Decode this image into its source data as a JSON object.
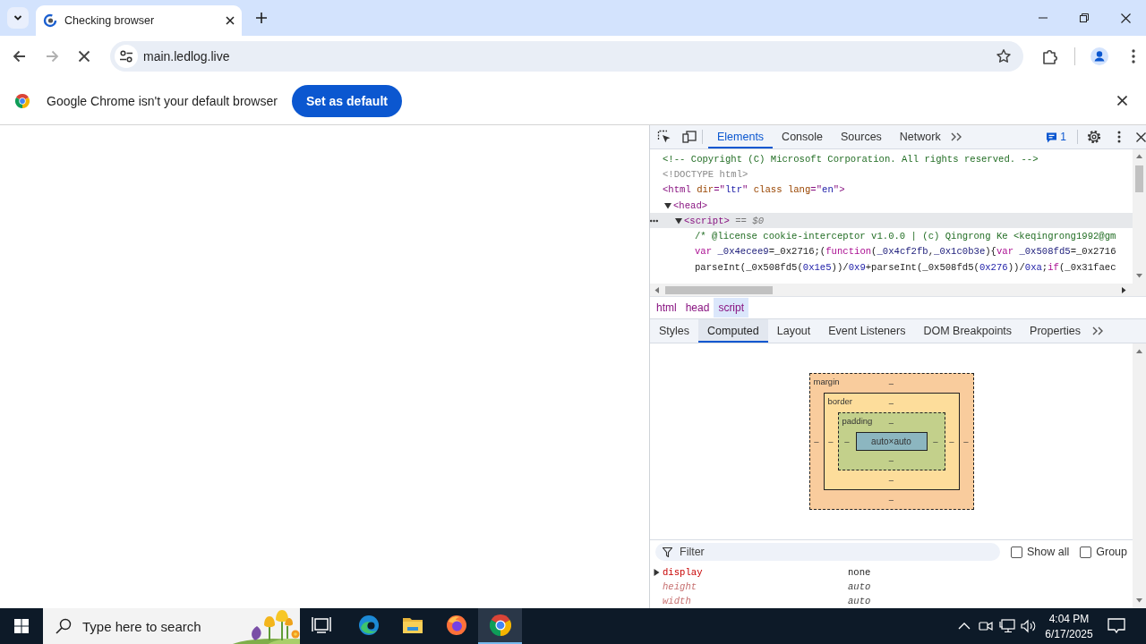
{
  "browser": {
    "tabs": [
      {
        "title": "Checking browser",
        "selected": true
      }
    ],
    "nav_buttons": [
      {
        "kind": "back",
        "disabled": false
      },
      {
        "kind": "forward",
        "disabled": true
      },
      {
        "kind": "stop",
        "disabled": false
      }
    ],
    "address": {
      "url": "main.ledlog.live",
      "bookmarked": false
    },
    "infobar": {
      "message": "Google Chrome isn't your default browser",
      "button": "Set as default"
    }
  },
  "devtools": {
    "tabs": [
      {
        "label": "Elements",
        "selected": true
      },
      {
        "label": "Console",
        "selected": false
      },
      {
        "label": "Sources",
        "selected": false
      },
      {
        "label": "Network",
        "selected": false
      }
    ],
    "issues": "1",
    "dom_tree": [
      {
        "selected": false,
        "tokens": [
          {
            "kind": "comment",
            "text": "<!-- Copyright (C) Microsoft Corporation. All rights reserved. -->"
          }
        ]
      },
      {
        "selected": false,
        "tokens": [
          {
            "kind": "doctype",
            "text": "<!DOCTYPE html>"
          }
        ]
      },
      {
        "selected": false,
        "tokens": [
          {
            "kind": "tag",
            "text": "<html"
          },
          {
            "kind": "attr",
            "text": " dir"
          },
          {
            "kind": "tag",
            "text": "=\""
          },
          {
            "kind": "value",
            "text": "ltr"
          },
          {
            "kind": "tag",
            "text": "\""
          },
          {
            "kind": "attr",
            "text": " class"
          },
          {
            "kind": "attr",
            "text": " lang"
          },
          {
            "kind": "tag",
            "text": "=\""
          },
          {
            "kind": "value",
            "text": "en"
          },
          {
            "kind": "tag",
            "text": "\">"
          }
        ],
        "children": [
          {
            "selected": false,
            "expanded": true,
            "tokens": [
              {
                "kind": "tag",
                "text": "<head>"
              }
            ],
            "children": [
              {
                "selected": true,
                "expanded": true,
                "tokens": [
                  {
                    "kind": "tag",
                    "text": "<script>"
                  },
                  {
                    "kind": "ref",
                    "text": " == $0"
                  }
                ],
                "children": [
                  {
                    "selected": false,
                    "tokens": [
                      {
                        "kind": "comment",
                        "text": "/* @license cookie-interceptor v1.0.0 | (c) Qingrong Ke <keqingrong1992@gm"
                      }
                    ]
                  },
                  {
                    "selected": false,
                    "tokens": [
                      {
                        "kind": "keyword",
                        "text": "var"
                      },
                      {
                        "kind": "def",
                        "text": " _0x4ecee9"
                      },
                      {
                        "kind": "plain",
                        "text": "=_0x2716;("
                      },
                      {
                        "kind": "keyword",
                        "text": "function"
                      },
                      {
                        "kind": "plain",
                        "text": "("
                      },
                      {
                        "kind": "def",
                        "text": "_0x4cf2fb"
                      },
                      {
                        "kind": "plain",
                        "text": ","
                      },
                      {
                        "kind": "def",
                        "text": "_0x1c0b3e"
                      },
                      {
                        "kind": "plain",
                        "text": "){"
                      },
                      {
                        "kind": "keyword",
                        "text": "var"
                      },
                      {
                        "kind": "def",
                        "text": " _0x508fd5"
                      },
                      {
                        "kind": "plain",
                        "text": "=_0x2716"
                      }
                    ]
                  },
                  {
                    "selected": false,
                    "tokens": [
                      {
                        "kind": "plain",
                        "text": "parseInt(_0x508fd5("
                      },
                      {
                        "kind": "number",
                        "text": "0x1e5"
                      },
                      {
                        "kind": "plain",
                        "text": "))/"
                      },
                      {
                        "kind": "number",
                        "text": "0x9"
                      },
                      {
                        "kind": "plain",
                        "text": "+parseInt(_0x508fd5("
                      },
                      {
                        "kind": "number",
                        "text": "0x276"
                      },
                      {
                        "kind": "plain",
                        "text": "))/"
                      },
                      {
                        "kind": "number",
                        "text": "0xa"
                      },
                      {
                        "kind": "plain",
                        "text": ";"
                      },
                      {
                        "kind": "keyword",
                        "text": "if"
                      },
                      {
                        "kind": "plain",
                        "text": "(_0x31faec"
                      }
                    ]
                  }
                ]
              }
            ]
          }
        ]
      }
    ],
    "breadcrumbs": [
      {
        "label": "html",
        "selected": false
      },
      {
        "label": "head",
        "selected": false
      },
      {
        "label": "script",
        "selected": true
      }
    ],
    "panel_tabs": [
      {
        "label": "Styles",
        "selected": false
      },
      {
        "label": "Computed",
        "selected": true
      },
      {
        "label": "Layout",
        "selected": false
      },
      {
        "label": "Event Listeners",
        "selected": false
      },
      {
        "label": "DOM Breakpoints",
        "selected": false
      },
      {
        "label": "Properties",
        "selected": false
      }
    ],
    "box_model": {
      "layers": [
        {
          "label": "margin",
          "top": "‒"
        },
        {
          "label": "border",
          "top": "‒"
        },
        {
          "label": "padding",
          "top": "‒"
        }
      ],
      "left_values": [
        "‒",
        "‒",
        "‒"
      ],
      "content": "auto×auto",
      "right_values": [
        "‒",
        "‒",
        "‒"
      ],
      "bottom_values": [
        "‒",
        "‒",
        "‒"
      ]
    },
    "filter": {
      "placeholder": "Filter"
    },
    "options": [
      {
        "label": "Show all",
        "checked": false
      },
      {
        "label": "Group",
        "checked": false
      }
    ],
    "properties": [
      {
        "name": "display",
        "value": "none",
        "kind": "expandable",
        "implicit": false
      },
      {
        "name": "height",
        "value": "auto",
        "kind": "plain",
        "implicit": true
      },
      {
        "name": "width",
        "value": "auto",
        "kind": "plain",
        "implicit": true
      }
    ]
  },
  "taskbar": {
    "search": {
      "placeholder": "Type here to search"
    },
    "apps": [
      {
        "kind": "task_view",
        "selected": false
      },
      {
        "kind": "edge",
        "selected": false
      },
      {
        "kind": "explorer",
        "selected": false
      },
      {
        "kind": "firefox",
        "selected": false
      },
      {
        "kind": "chrome",
        "selected": true
      }
    ],
    "clock": {
      "time": "4:04 PM",
      "date": "6/17/2025"
    }
  }
}
